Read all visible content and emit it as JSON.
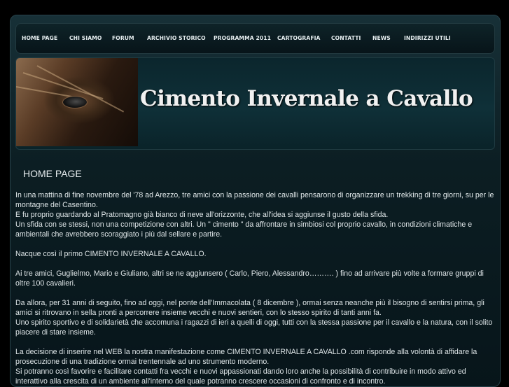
{
  "nav": {
    "items": [
      {
        "label": "HOME PAGE"
      },
      {
        "label": "CHI SIAMO"
      },
      {
        "label": "FORUM"
      },
      {
        "label": "ARCHIVIO STORICO"
      },
      {
        "label": "PROGRAMMA 2011"
      },
      {
        "label": "CARTOGRAFIA"
      },
      {
        "label": "CONTATTI"
      },
      {
        "label": "NEWS"
      },
      {
        "label": "INDIRIZZI UTILI"
      }
    ]
  },
  "banner": {
    "title": "Cimento Invernale a Cavallo"
  },
  "main": {
    "section_title": "HOME PAGE",
    "paragraphs": [
      "In una mattina di fine novembre del '78 ad Arezzo, tre amici con la passione dei cavalli pensarono di organizzare un trekking di tre giorni, su per le montagne del Casentino.",
      "E fu proprio guardando al Pratomagno già bianco di neve all'orizzonte, che all'idea si aggiunse il gusto della sfida.",
      "Un sfida con se stessi, non una competizione con altri. Un \" cimento \" da affrontare in simbiosi col proprio cavallo, in condizioni climatiche e ambientali che avrebbero scoraggiato i più dal sellare e partire.",
      "Nacque così il primo CIMENTO INVERNALE A CAVALLO.",
      "Ai tre amici, Guglielmo, Mario e Giuliano, altri se ne aggiunsero ( Carlo, Piero, Alessandro………. ) fino ad arrivare più volte a formare gruppi di oltre 100 cavalieri.",
      "Da allora, per 31 anni di seguito, fino ad oggi, nel ponte dell'Immacolata ( 8 dicembre ), ormai senza neanche più il bisogno di sentirsi prima, gli amici si ritrovano in sella pronti a percorrere insieme vecchi e nuovi sentieri, con lo stesso spirito di tanti anni fa.",
      "Uno spirito sportivo e di solidarietà che accomuna i ragazzi di ieri a quelli di oggi, tutti con la stessa passione per il cavallo e la natura, con il solito piacere di stare insieme.",
      "La decisione di inserire nel WEB la nostra manifestazione come CIMENTO INVERNALE A CAVALLO .com risponde alla volontà di affidare la prosecuzione di una tradizione ormai trentennale ad uno strumento moderno.",
      "Si potranno così favorire e facilitare contatti fra vecchi e nuovi appassionati dando loro anche la possibilità di contribuire in modo attivo ed interattivo alla crescita di un ambiente all'interno del quale potranno crescere occasioni di confronto e di incontro."
    ]
  }
}
